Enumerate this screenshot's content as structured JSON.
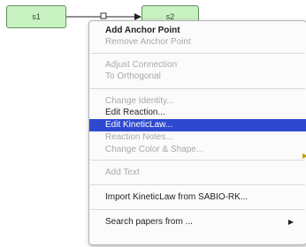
{
  "diagram": {
    "nodes": [
      {
        "id": "s1",
        "label": "s1"
      },
      {
        "id": "s2",
        "label": "s2"
      }
    ]
  },
  "context_menu": {
    "items": [
      {
        "label": "Add Anchor Point",
        "enabled": true,
        "bold": true
      },
      {
        "label": "Remove Anchor Point",
        "enabled": false
      },
      {
        "label": "Adjust Connection",
        "enabled": false
      },
      {
        "label": "To Orthogonal",
        "enabled": false
      },
      {
        "label": "Change Identity...",
        "enabled": false
      },
      {
        "label": "Edit Reaction...",
        "enabled": true
      },
      {
        "label": "Edit KineticLaw...",
        "enabled": true,
        "highlighted": true
      },
      {
        "label": "Reaction Notes...",
        "enabled": false
      },
      {
        "label": "Change Color & Shape...",
        "enabled": false
      },
      {
        "label": "Add Text",
        "enabled": false
      },
      {
        "label": "Import KineticLaw from SABIO-RK...",
        "enabled": true
      },
      {
        "label": "Search papers from ...",
        "enabled": true,
        "has_submenu": true
      }
    ],
    "submenu_arrow": "▶"
  },
  "colors": {
    "node_fill": "#c9f2c2",
    "node_border": "#5d8f56",
    "highlight": "#2e49cf"
  }
}
